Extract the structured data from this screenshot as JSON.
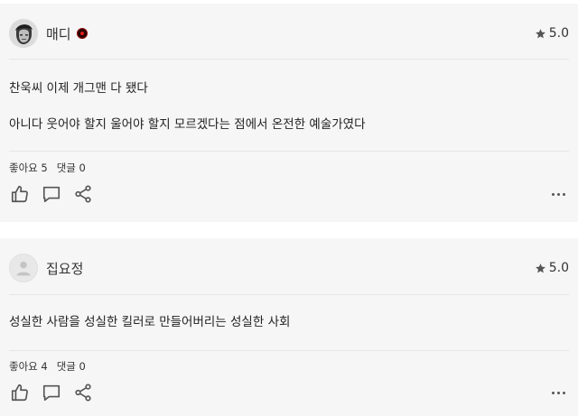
{
  "reviews": [
    {
      "username": "매디",
      "rating": "5.0",
      "lines": [
        "찬욱씨 이제 개그맨 다 됐다",
        "아니다 웃어야 할지 울어야 할지 모르겠다는 점에서 온전한 예술가였다"
      ],
      "likes_label": "좋아요 5",
      "comments_label": "댓글 0",
      "avatar": "user-photo",
      "has_badge": true
    },
    {
      "username": "집요정",
      "rating": "5.0",
      "lines": [
        "성실한 사람을 성실한 킬러로 만들어버리는 성실한 사회"
      ],
      "likes_label": "좋아요 4",
      "comments_label": "댓글 0",
      "avatar": "default-user-icon",
      "has_badge": false
    }
  ],
  "icons": {
    "rating": "star-icon",
    "like": "thumbs-up-icon",
    "comment": "comment-bubble-icon",
    "share": "share-icon",
    "more": "more-horizontal-icon"
  },
  "colors": {
    "card_bg": "#f6f6f6",
    "divider": "#e6e6e6",
    "icon": "#555555",
    "badge": "#e0201c"
  }
}
